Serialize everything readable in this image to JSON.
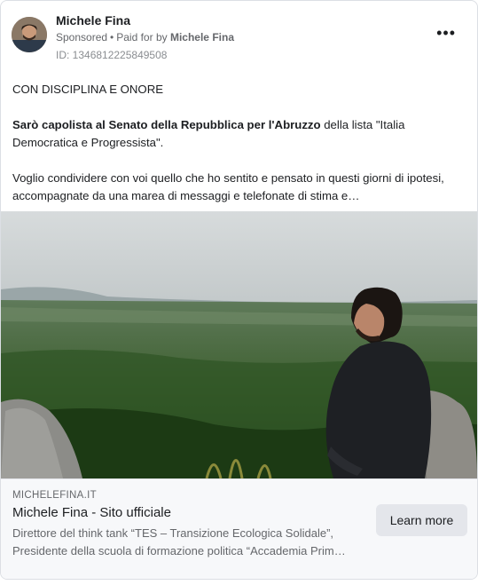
{
  "post": {
    "advertiser_name": "Michele Fina",
    "sponsored_label": "Sponsored",
    "paid_for_prefix": "Paid for by",
    "paid_for_name": "Michele Fina",
    "ad_id": "ID: 1346812225849508",
    "more_icon": "more-horizontal-icon"
  },
  "body": {
    "line1": "CON DISCIPLINA E ONORE",
    "para2_bold": "Sarò capolista al Senato della Repubblica per l'Abruzzo",
    "para2_rest": " della lista \"Italia Democratica e Progressista\".",
    "para3": "Voglio condividere con voi quello che ho sentito e pensato in questi giorni di ipotesi, accompagnate da una marea di messaggi e telefonate di stima e…"
  },
  "link": {
    "domain": "MICHELEFINA.IT",
    "title": "Michele Fina - Sito ufficiale",
    "desc_line1": "Direttore del think tank “TES – Transizione Ecologica Solidale”,",
    "desc_line2": "Presidente della scuola di formazione politica “Accademia Prim…",
    "cta_label": "Learn more"
  }
}
